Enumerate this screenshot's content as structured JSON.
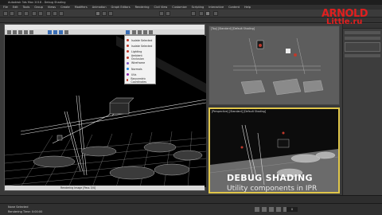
{
  "window": {
    "title": "Autodesk 3ds Max 2018 - Debug Shading"
  },
  "menu": [
    "File",
    "Edit",
    "Tools",
    "Group",
    "Views",
    "Create",
    "Modifiers",
    "Animation",
    "Graph Editors",
    "Rendering",
    "Civil View",
    "Customize",
    "Scripting",
    "Interactive",
    "Content",
    "Help"
  ],
  "watermark": {
    "line1": "ARNOLD",
    "line2": "Little.ru"
  },
  "viewport_window": {
    "title": "",
    "status": "Rendering Image [Pass 3/4]",
    "popup_items": [
      {
        "label": "Isolate Selected",
        "color": "#c0392b"
      },
      {
        "label": "Isolate Selected",
        "color": "#c0392b"
      },
      {
        "label": "Lighting",
        "color": "#c0392b"
      },
      {
        "label": "Ambient Occlusion",
        "color": "#c0392b"
      },
      {
        "label": "Wireframe",
        "color": "#7e57c2"
      },
      {
        "label": "Normals",
        "color": "#1e88e5"
      },
      {
        "label": "UVs",
        "color": "#8e24aa"
      },
      {
        "label": "Barycentric Coordinates",
        "color": "#c0392b"
      }
    ]
  },
  "viewport_top": {
    "label": "[Top] [Standard] [Default Shading]"
  },
  "viewport_bottom": {
    "label": "[Perspective] [Standard] [Default Shading]"
  },
  "caption": {
    "title": "DEBUG SHADING",
    "subtitle": "Utility components in IPR"
  },
  "status": {
    "line1": "None Selected",
    "line2": "Rendering Time: 0:00:00",
    "frame": "0"
  },
  "colors": {
    "viewport_active_border": "#e0c64a",
    "watermark": "#e01f1f"
  }
}
